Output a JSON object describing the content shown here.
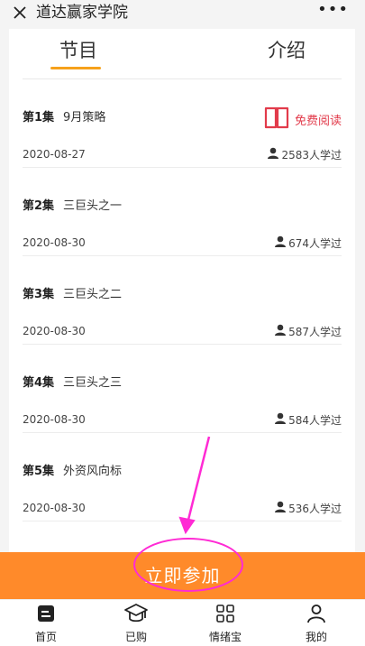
{
  "header": {
    "title": "道达赢家学院",
    "more": "•••"
  },
  "tabs": [
    {
      "label": "节目"
    },
    {
      "label": "介绍"
    }
  ],
  "free_label": "免费阅读",
  "episodes": [
    {
      "num": "第1集",
      "title": "9月策略",
      "date": "2020-08-27",
      "count": "2583人学过"
    },
    {
      "num": "第2集",
      "title": "三巨头之一",
      "date": "2020-08-30",
      "count": "674人学过"
    },
    {
      "num": "第3集",
      "title": "三巨头之二",
      "date": "2020-08-30",
      "count": "587人学过"
    },
    {
      "num": "第4集",
      "title": "三巨头之三",
      "date": "2020-08-30",
      "count": "584人学过"
    },
    {
      "num": "第5集",
      "title": "外资风向标",
      "date": "2020-08-30",
      "count": "536人学过"
    }
  ],
  "join_label": "立即参加",
  "nav": [
    {
      "label": "首页",
      "icon": "home-icon"
    },
    {
      "label": "已购",
      "icon": "graduation-cap-icon"
    },
    {
      "label": "情绪宝",
      "icon": "grid-icon"
    },
    {
      "label": "我的",
      "icon": "user-icon"
    }
  ],
  "colors": {
    "accent": "#f6a11c",
    "join": "#ff8a2a",
    "free": "#e23b4b",
    "annotation": "#ff2ad4"
  }
}
